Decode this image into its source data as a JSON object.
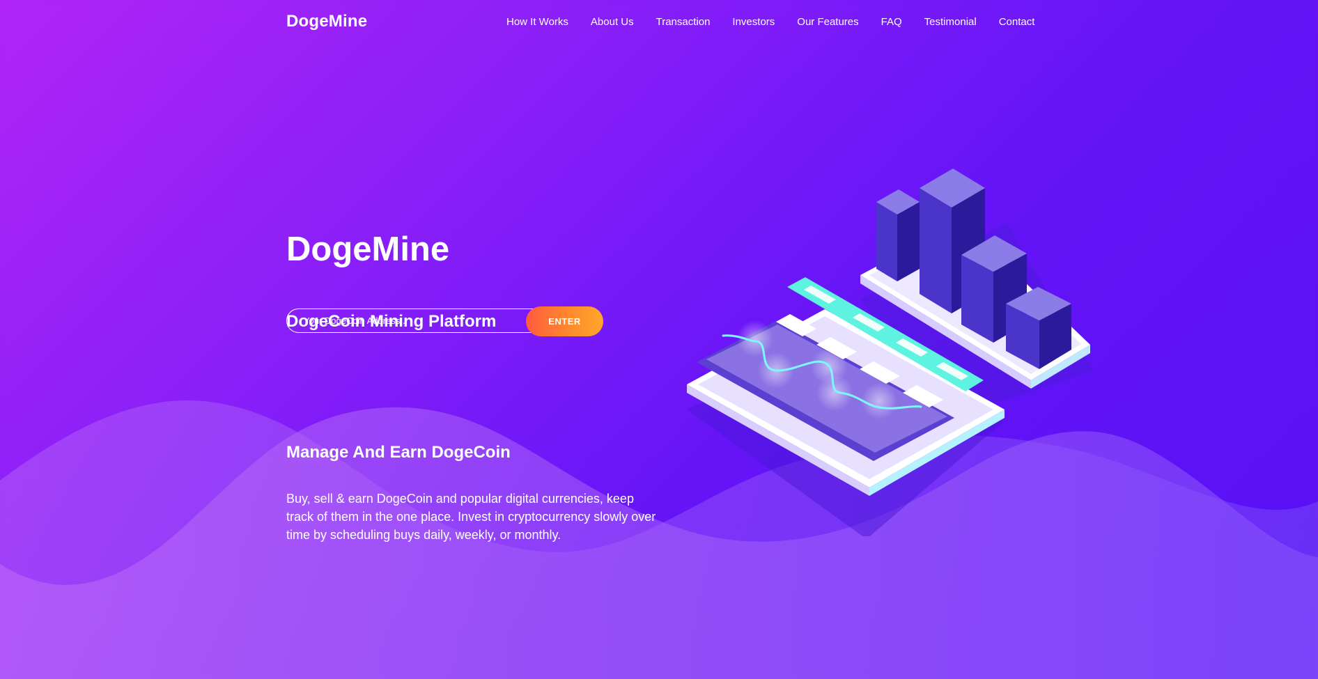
{
  "brand": {
    "logo_text": "DogeMine"
  },
  "nav": {
    "items": [
      {
        "label": "How It Works"
      },
      {
        "label": "About Us"
      },
      {
        "label": "Transaction"
      },
      {
        "label": "Investors"
      },
      {
        "label": "Our Features"
      },
      {
        "label": "FAQ"
      },
      {
        "label": "Testimonial"
      },
      {
        "label": "Contact"
      }
    ]
  },
  "hero": {
    "title": "DogeMine",
    "subtitle": "DogeCoin Mining Platform",
    "address_input": {
      "value": "",
      "placeholder": "Your DogeCoin Address..."
    },
    "enter_label": "ENTER"
  },
  "about": {
    "heading": "Manage And Earn DogeCoin",
    "text": "Buy, sell & earn DogeCoin and popular digital currencies, keep track of them in the one place. Invest in cryptocurrency slowly over time by scheduling buys daily, weekly, or monthly."
  },
  "illustration": {
    "icon": "isometric-crypto-chart-illustration"
  },
  "colors": {
    "background_start": "#b025f7",
    "background_end": "#5710f5",
    "button_start": "#ff5b3e",
    "button_end": "#ffa62a",
    "accent_teal": "#5ef2e0",
    "bar_purple": "#4a30c9"
  }
}
